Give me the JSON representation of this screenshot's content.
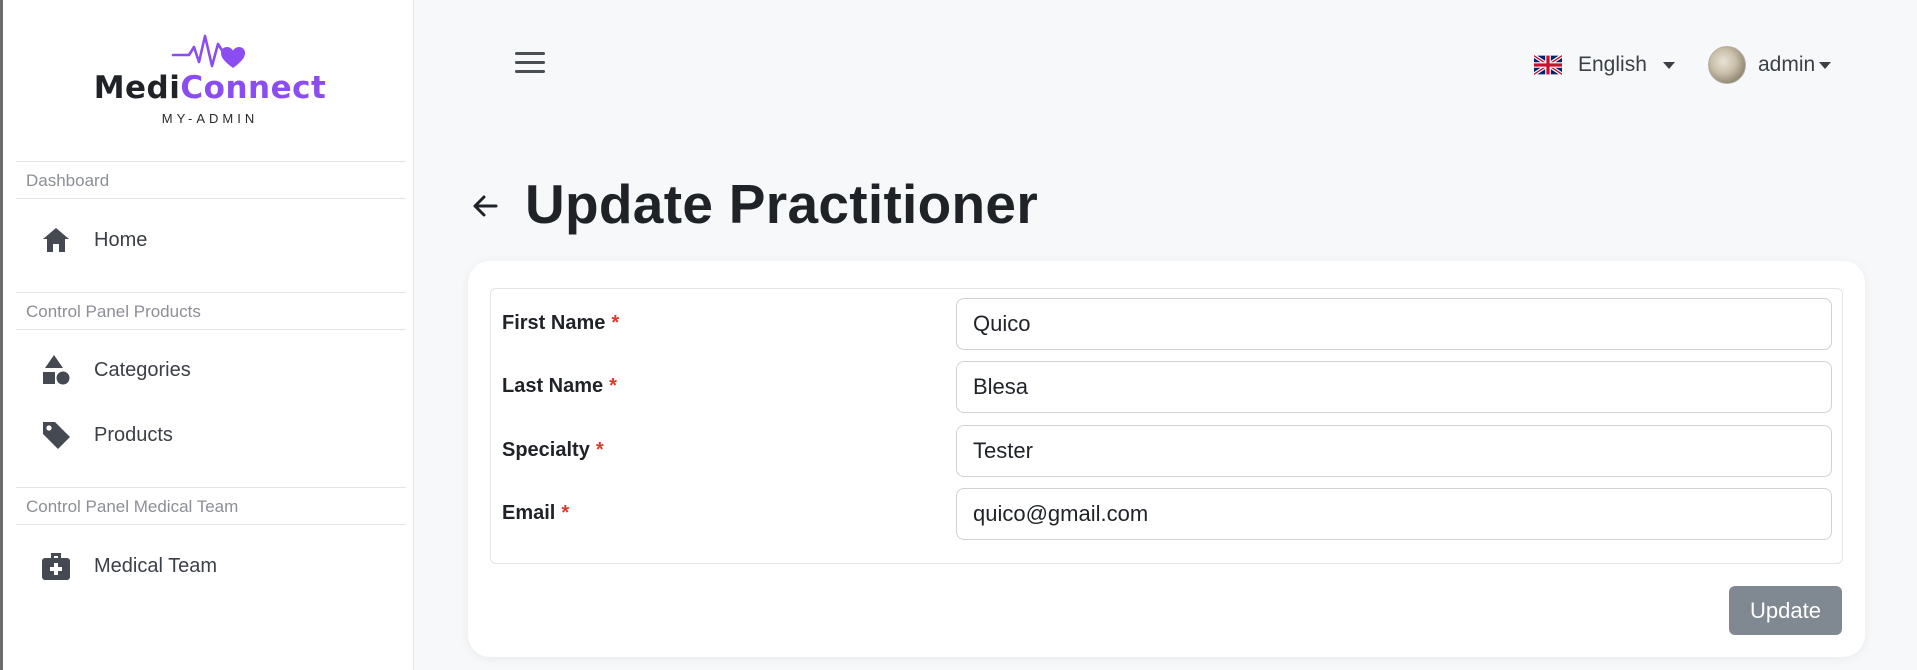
{
  "app": {
    "logo_part1": "Medi",
    "logo_part2": "Connect",
    "logo_subtitle": "MY-ADMIN",
    "brand_color": "#8b4cf2"
  },
  "sidebar": {
    "sections": [
      {
        "title": "Dashboard",
        "items": [
          {
            "label": "Home",
            "icon": "home-icon"
          }
        ]
      },
      {
        "title": "Control Panel Products",
        "items": [
          {
            "label": "Categories",
            "icon": "shapes-icon"
          },
          {
            "label": "Products",
            "icon": "tag-icon"
          }
        ]
      },
      {
        "title": "Control Panel Medical Team",
        "items": [
          {
            "label": "Medical Team",
            "icon": "medical-kit-icon"
          }
        ]
      }
    ]
  },
  "topbar": {
    "language": "English",
    "language_icon": "uk-flag-icon",
    "user": "admin"
  },
  "page": {
    "title": "Update Practitioner"
  },
  "form": {
    "required_mark": "*",
    "fields": [
      {
        "label": "First Name",
        "value": "Quico"
      },
      {
        "label": "Last Name",
        "value": "Blesa"
      },
      {
        "label": "Specialty",
        "value": "Tester"
      },
      {
        "label": "Email",
        "value": "quico@gmail.com"
      }
    ],
    "submit_label": "Update"
  }
}
